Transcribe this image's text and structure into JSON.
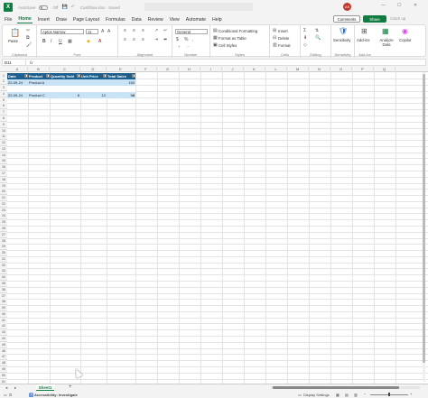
{
  "titlebar": {
    "autosave_label": "AutoSave",
    "autosave_state": "Off",
    "file_name": "Cashflow.xlsx · Saved",
    "avatar_initials": "AS"
  },
  "menu": {
    "tabs": [
      "File",
      "Home",
      "Insert",
      "Draw",
      "Page Layout",
      "Formulas",
      "Data",
      "Review",
      "View",
      "Automate",
      "Help"
    ],
    "active_tab": "Home",
    "comments_label": "Comments",
    "share_label": "Share",
    "catchup_label": "Catch up"
  },
  "ribbon": {
    "clipboard": {
      "paste_label": "Paste",
      "group_label": "Clipboard"
    },
    "font": {
      "font_name": "Aptos Narrow",
      "font_size": "11",
      "group_label": "Font"
    },
    "alignment": {
      "group_label": "Alignment"
    },
    "number": {
      "format": "General",
      "group_label": "Number"
    },
    "styles": {
      "conditional_formatting": "Conditional Formatting",
      "format_as_table": "Format as Table",
      "cell_styles": "Cell Styles",
      "group_label": "Styles"
    },
    "cells": {
      "insert": "Insert",
      "delete": "Delete",
      "format": "Format",
      "group_label": "Cells"
    },
    "editing": {
      "group_label": "Editing"
    },
    "sensitivity": {
      "label": "Sensitivity",
      "group_label": "Sensitivity"
    },
    "addins": {
      "label": "Add-ins",
      "group_label": "Add-ins"
    },
    "analyze": {
      "label": "Analyze Data"
    },
    "copilot": {
      "label": "Copilot"
    }
  },
  "formula_bar": {
    "cell_ref": "D11",
    "fx": "fx",
    "value": ""
  },
  "grid": {
    "columns": [
      "A",
      "B",
      "C",
      "D",
      "E",
      "F",
      "G",
      "H",
      "I",
      "J",
      "K",
      "L",
      "M",
      "N",
      "O",
      "P",
      "Q"
    ],
    "row_count": 51,
    "table_headers": [
      "Date",
      "Product",
      "Quantity Sold",
      "Unit Price",
      "Total Sales"
    ],
    "rows": [
      {
        "row": 2,
        "cells": [
          "22-09-24",
          "Product A",
          "",
          "",
          "150"
        ]
      },
      {
        "row": 4,
        "cells": [
          "22-09-24",
          "Product C",
          "8",
          "12",
          "96"
        ]
      }
    ]
  },
  "sheets": {
    "tabs": [
      "Sheet1"
    ],
    "active": "Sheet1"
  },
  "status": {
    "accessibility": "Accessibility: Investigate",
    "display_settings": "Display Settings"
  },
  "colors": {
    "accent": "#107c41",
    "table_header": "#1f5f8b",
    "table_band": "#c7e3f5"
  }
}
